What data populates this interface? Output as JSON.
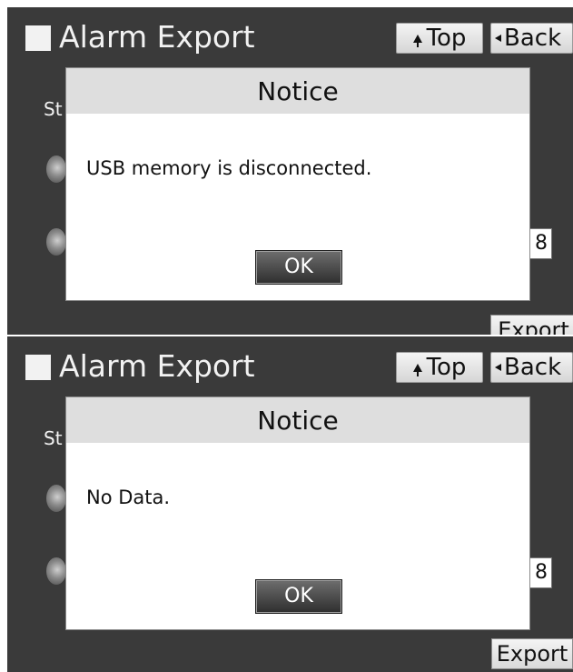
{
  "screens": [
    {
      "title": "Alarm Export",
      "top_label": "Top",
      "back_label": "Back",
      "partial_label": "St",
      "date_fragment": "8",
      "export_label": "Export",
      "dialog": {
        "title": "Notice",
        "message": "USB memory is disconnected.",
        "ok_label": "OK"
      }
    },
    {
      "title": "Alarm Export",
      "top_label": "Top",
      "back_label": "Back",
      "partial_label": "St",
      "date_fragment": "8",
      "export_label": "Export",
      "dialog": {
        "title": "Notice",
        "message": "No Data.",
        "ok_label": "OK"
      }
    }
  ],
  "colors": {
    "panel_background": "#3a3a3a",
    "dialog_titlebar": "#dedede",
    "ok_button": "#3c3c3c"
  },
  "icons": [
    "square-icon",
    "arrow-up-icon",
    "arrow-left-icon",
    "radio-icon"
  ]
}
